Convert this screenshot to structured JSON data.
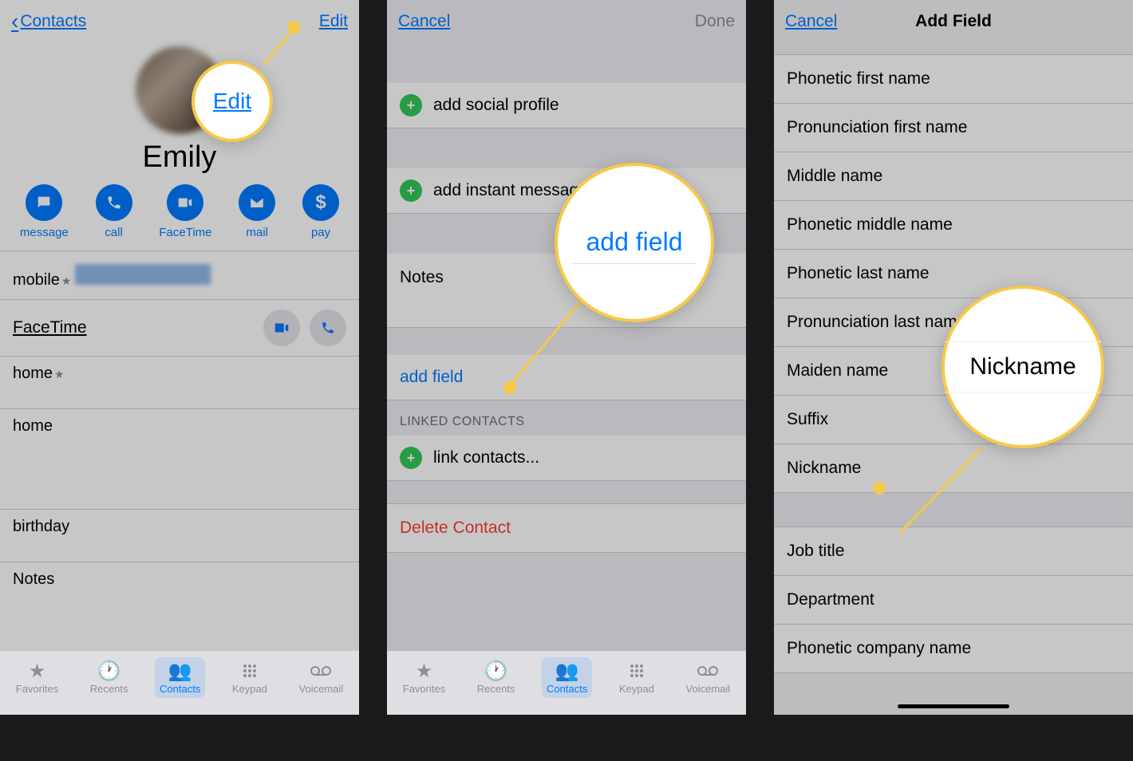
{
  "screen1": {
    "back_label": "Contacts",
    "edit_label": "Edit",
    "contact_name": "Emily",
    "actions": [
      {
        "label": "message"
      },
      {
        "label": "call"
      },
      {
        "label": "FaceTime"
      },
      {
        "label": "mail"
      },
      {
        "label": "pay"
      }
    ],
    "mobile_label": "mobile",
    "facetime_label": "FaceTime",
    "home1_label": "home",
    "home2_label": "home",
    "birthday_label": "birthday",
    "notes_label": "Notes"
  },
  "screen2": {
    "cancel_label": "Cancel",
    "done_label": "Done",
    "add_social": "add social profile",
    "add_im": "add instant message",
    "notes_label": "Notes",
    "add_field_label": "add field",
    "linked_header": "LINKED CONTACTS",
    "link_contacts": "link contacts...",
    "delete_label": "Delete Contact"
  },
  "screen3": {
    "cancel_label": "Cancel",
    "title": "Add Field",
    "fields": [
      "Phonetic first name",
      "Pronunciation first name",
      "Middle name",
      "Phonetic middle name",
      "Phonetic last name",
      "Pronunciation last name",
      "Maiden name",
      "Suffix",
      "Nickname"
    ],
    "fields2": [
      "Job title",
      "Department",
      "Phonetic company name"
    ]
  },
  "tabs": [
    {
      "label": "Favorites"
    },
    {
      "label": "Recents"
    },
    {
      "label": "Contacts"
    },
    {
      "label": "Keypad"
    },
    {
      "label": "Voicemail"
    }
  ],
  "callouts": {
    "edit": "Edit",
    "add_field": "add field",
    "nickname": "Nickname"
  }
}
